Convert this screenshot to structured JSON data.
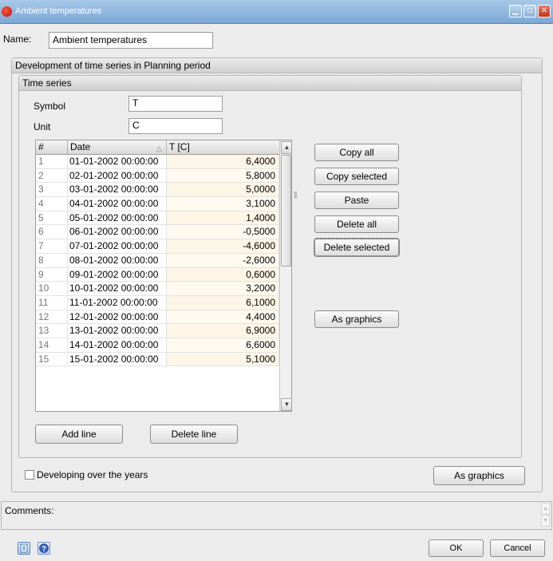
{
  "window": {
    "title": "Ambient temperatures",
    "min_glyph": "▁",
    "max_glyph": "□",
    "close_glyph": "✕"
  },
  "name": {
    "label": "Name:",
    "value": "Ambient temperatures"
  },
  "development_group": {
    "title": "Development of time series in Planning period"
  },
  "time_series_group": {
    "title": "Time series"
  },
  "symbol": {
    "label": "Symbol",
    "value": "T"
  },
  "unit": {
    "label": "Unit",
    "value": "C"
  },
  "table": {
    "columns": [
      "#",
      "Date",
      "T [C]"
    ],
    "sort_glyph": "△",
    "rows": [
      {
        "n": "1",
        "date": "01-01-2002 00:00:00",
        "value": "6,4000"
      },
      {
        "n": "2",
        "date": "02-01-2002 00:00:00",
        "value": "5,8000"
      },
      {
        "n": "3",
        "date": "03-01-2002 00:00:00",
        "value": "5,0000"
      },
      {
        "n": "4",
        "date": "04-01-2002 00:00:00",
        "value": "3,1000"
      },
      {
        "n": "5",
        "date": "05-01-2002 00:00:00",
        "value": "1,4000"
      },
      {
        "n": "6",
        "date": "06-01-2002 00:00:00",
        "value": "-0,5000"
      },
      {
        "n": "7",
        "date": "07-01-2002 00:00:00",
        "value": "-4,6000"
      },
      {
        "n": "8",
        "date": "08-01-2002 00:00:00",
        "value": "-2,6000"
      },
      {
        "n": "9",
        "date": "09-01-2002 00:00:00",
        "value": "0,6000"
      },
      {
        "n": "10",
        "date": "10-01-2002 00:00:00",
        "value": "3,2000"
      },
      {
        "n": "11",
        "date": "11-01-2002 00:00:00",
        "value": "6,1000"
      },
      {
        "n": "12",
        "date": "12-01-2002 00:00:00",
        "value": "4,4000"
      },
      {
        "n": "13",
        "date": "13-01-2002 00:00:00",
        "value": "6,9000"
      },
      {
        "n": "14",
        "date": "14-01-2002 00:00:00",
        "value": "6,6000"
      },
      {
        "n": "15",
        "date": "15-01-2002 00:00:00",
        "value": "5,1000"
      }
    ]
  },
  "side_buttons": {
    "copy_all": "Copy all",
    "copy_selected": "Copy selected",
    "paste": "Paste",
    "delete_all": "Delete all",
    "delete_selected": "Delete selected",
    "as_graphics": "As graphics"
  },
  "line_buttons": {
    "add_line": "Add line",
    "delete_line": "Delete line"
  },
  "developing_over_years": {
    "label": "Developing over the years",
    "checked": false
  },
  "as_graphics_outer": "As graphics",
  "comments": {
    "label": "Comments:"
  },
  "footer": {
    "ok": "OK",
    "cancel": "Cancel"
  },
  "icons": [
    "app-icon",
    "minimize-icon",
    "maximize-icon",
    "close-icon",
    "sort-ascending-icon",
    "scroll-up-icon",
    "scroll-down-icon",
    "grip-icon",
    "document-icon",
    "help-icon"
  ],
  "colors": {
    "titlebar": "#7ba7d4",
    "dialog_bg": "#ececec",
    "value_cell": "#fdf5e6",
    "help_icon": "#2f5fb8"
  }
}
